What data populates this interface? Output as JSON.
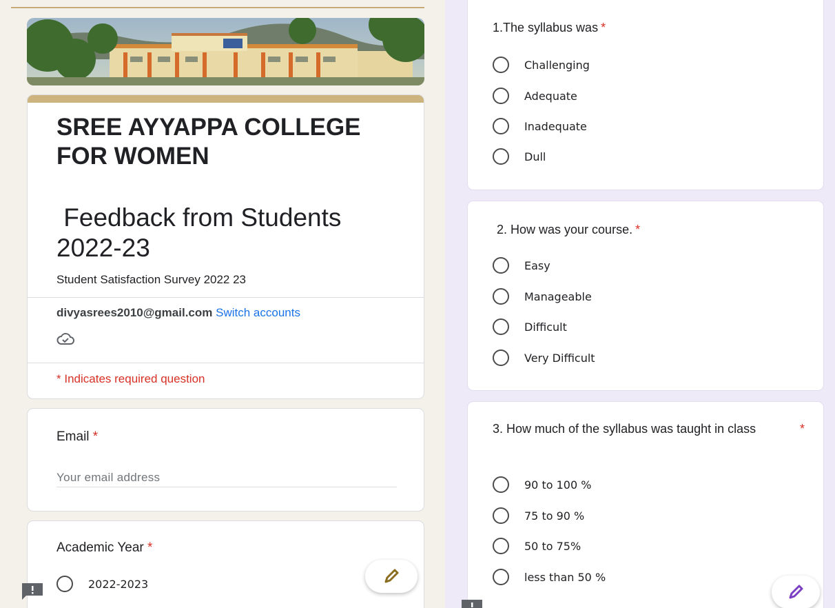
{
  "left": {
    "college_name": "SREE AYYAPPA COLLEGE FOR WOMEN",
    "form_title": " Feedback from Students 2022-23",
    "description": "Student Satisfaction Survey 2022 23",
    "account_email": "divyasrees2010@gmail.com",
    "switch_accounts": "Switch accounts",
    "required_note_star": "*",
    "required_note": "Indicates required question",
    "email_question": "Email",
    "email_placeholder": "Your email address",
    "academic_year_question": "Academic Year",
    "academic_year_options": [
      "2022-2023"
    ],
    "required_star": "*"
  },
  "right": {
    "questions": [
      {
        "label": "1.The syllabus was",
        "options": [
          "Challenging",
          "Adequate",
          "Inadequate",
          "Dull"
        ]
      },
      {
        "label": "2. How was your course.",
        "options": [
          "Easy",
          "Manageable",
          "Difficult",
          "Very Difficult"
        ]
      },
      {
        "label": "3.  How much of the syllabus was taught in class",
        "options": [
          "90 to 100 %",
          "75 to 90 %",
          "50 to 75%",
          "less than 50 %"
        ]
      }
    ]
  },
  "icons": {
    "cloud": "cloud-check-icon",
    "edit": "pencil-icon",
    "feedback": "report-feedback-icon"
  },
  "colors": {
    "accent": "#cdb37e",
    "required": "#d93025",
    "link": "#1a73e8",
    "left_background": "#f4f1ea",
    "right_background": "#efeaf8",
    "fab_pencil_left": "#8a6d1f",
    "fab_pencil_right": "#7b3fc4"
  }
}
